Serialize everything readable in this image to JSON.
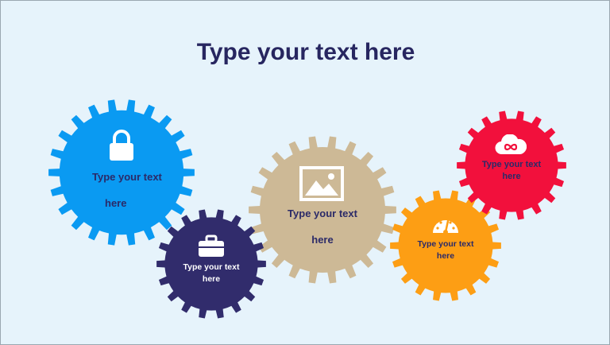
{
  "title": "Type your text here",
  "colors": {
    "background": "#e6f3fb",
    "title": "#272660"
  },
  "gears": [
    {
      "id": "blue",
      "color": "#0a9af2",
      "icon": "lock-icon",
      "text_color": "#2b2a68",
      "line1": "Type your text",
      "line2": "here"
    },
    {
      "id": "navy",
      "color": "#312c6c",
      "icon": "briefcase-icon",
      "text_color": "#ffffff",
      "line1": "Type your text",
      "line2": "here"
    },
    {
      "id": "tan",
      "color": "#cdb996",
      "icon": "image-icon",
      "text_color": "#2b2a68",
      "line1": "Type your text",
      "line2": "here"
    },
    {
      "id": "orange",
      "color": "#fd9e14",
      "icon": "speedometer-icon",
      "text_color": "#2b2a68",
      "line1": "Type your text",
      "line2": "here"
    },
    {
      "id": "red",
      "color": "#f2103c",
      "icon": "cloud-infinity-icon",
      "text_color": "#2b2a68",
      "line1": "Type your text",
      "line2": "here"
    }
  ]
}
